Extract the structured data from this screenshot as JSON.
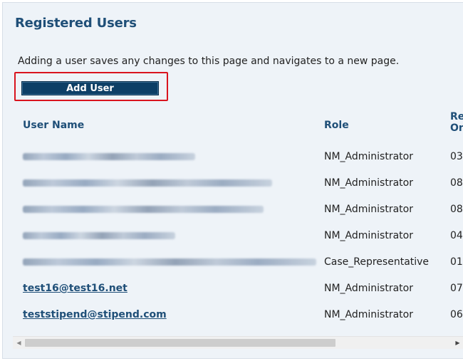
{
  "section": {
    "title": "Registered Users",
    "description": "Adding a user saves any changes to this page and navigates to a new page.",
    "add_user_label": "Add User"
  },
  "table": {
    "headers": {
      "user_name": "User Name",
      "role": "Role",
      "registered_line1": "Re",
      "registered_line2": "On"
    },
    "rows": [
      {
        "user_name": "",
        "redacted": true,
        "role": "NM_Administrator",
        "date_fragment": "03"
      },
      {
        "user_name": "",
        "redacted": true,
        "role": "NM_Administrator",
        "date_fragment": "08"
      },
      {
        "user_name": "",
        "redacted": true,
        "role": "NM_Administrator",
        "date_fragment": "08"
      },
      {
        "user_name": "",
        "redacted": true,
        "role": "NM_Administrator",
        "date_fragment": "04"
      },
      {
        "user_name": "",
        "redacted": true,
        "role": "Case_Representative",
        "date_fragment": "01"
      },
      {
        "user_name": "test16@test16.net",
        "redacted": false,
        "role": "NM_Administrator",
        "date_fragment": "07"
      },
      {
        "user_name": "teststipend@stipend.com",
        "redacted": false,
        "role": "NM_Administrator",
        "date_fragment": "06"
      }
    ]
  },
  "scrollbar": {
    "left_arrow_icon": "triangle-left",
    "right_arrow_icon": "triangle-right"
  },
  "colors": {
    "panel_bg": "#eef3f8",
    "heading": "#1f4f78",
    "button_bg": "#0d3f66",
    "highlight": "#d9141e"
  }
}
